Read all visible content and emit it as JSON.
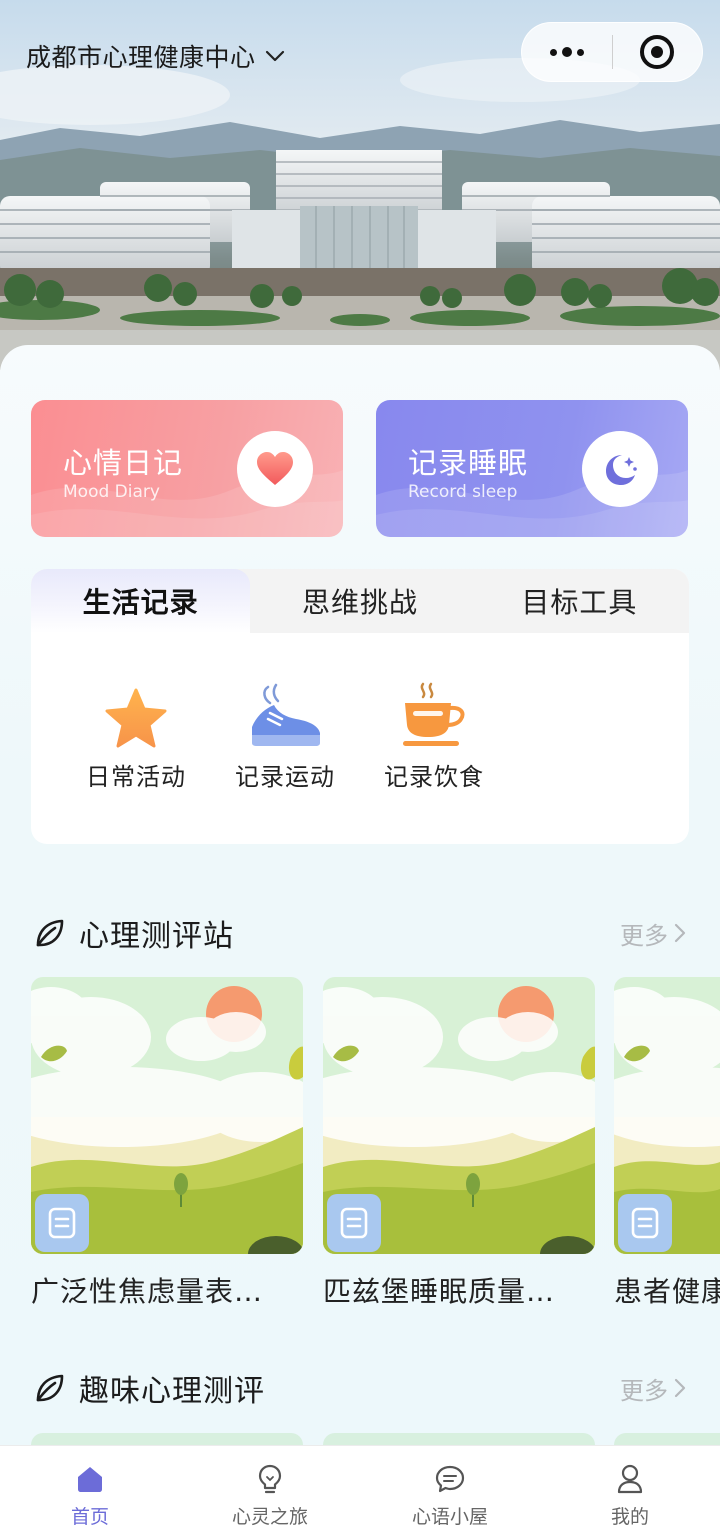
{
  "header": {
    "location": "成都市心理健康中心",
    "icons": [
      "chevron-down-icon",
      "more-dots-icon",
      "target-icon"
    ]
  },
  "quick_cards": [
    {
      "title": "心情日记",
      "subtitle": "Mood Diary",
      "icon": "heart-icon",
      "color": "#fb8e92"
    },
    {
      "title": "记录睡眠",
      "subtitle": "Record sleep",
      "icon": "moon-icon",
      "color": "#8888ee"
    }
  ],
  "tabs": [
    {
      "label": "生活记录",
      "active": true
    },
    {
      "label": "思维挑战",
      "active": false
    },
    {
      "label": "目标工具",
      "active": false
    }
  ],
  "tools": [
    {
      "label": "日常活动",
      "icon": "star-icon"
    },
    {
      "label": "记录运动",
      "icon": "sneaker-icon"
    },
    {
      "label": "记录饮食",
      "icon": "coffee-cup-icon"
    }
  ],
  "sections": {
    "assessment": {
      "title": "心理测评站",
      "more": "更多",
      "items": [
        "广泛性焦虑量表…",
        "匹兹堡睡眠质量…",
        "患者健康"
      ]
    },
    "fun": {
      "title": "趣味心理测评",
      "more": "更多"
    }
  },
  "bottom_nav": [
    {
      "label": "首页",
      "icon": "home-icon",
      "active": true
    },
    {
      "label": "心灵之旅",
      "icon": "lightbulb-icon",
      "active": false
    },
    {
      "label": "心语小屋",
      "icon": "chat-bubble-icon",
      "active": false
    },
    {
      "label": "我的",
      "icon": "user-icon",
      "active": false
    }
  ],
  "colors": {
    "accent": "#6c6cd8",
    "mood_card": "#fb8e92",
    "sleep_card": "#8888ee",
    "background": "#eef8fb"
  }
}
